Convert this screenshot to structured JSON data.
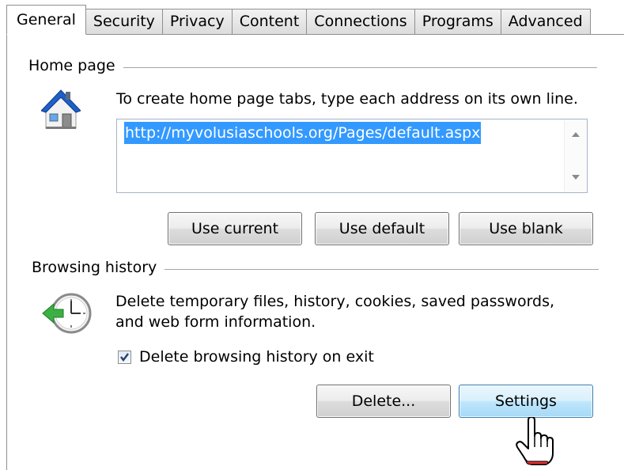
{
  "tabs": [
    {
      "label": "General",
      "active": true
    },
    {
      "label": "Security",
      "active": false
    },
    {
      "label": "Privacy",
      "active": false
    },
    {
      "label": "Content",
      "active": false
    },
    {
      "label": "Connections",
      "active": false
    },
    {
      "label": "Programs",
      "active": false
    },
    {
      "label": "Advanced",
      "active": false
    }
  ],
  "home_page": {
    "title": "Home page",
    "description": "To create home page tabs, type each address on its own line.",
    "url": "http://myvolusiaschools.org/Pages/default.aspx",
    "icon": "house-icon",
    "buttons": {
      "use_current": "Use current",
      "use_default": "Use default",
      "use_blank": "Use blank"
    }
  },
  "browsing_history": {
    "title": "Browsing history",
    "description_line1": "Delete temporary files, history, cookies, saved passwords,",
    "description_line2": "and web form information.",
    "icon": "clock-delete-icon",
    "checkbox_label": "Delete browsing history on exit",
    "checkbox_checked": true,
    "buttons": {
      "delete": "Delete...",
      "settings": "Settings"
    }
  },
  "colors": {
    "selection": "#3399ff",
    "hot_button_border": "#3c7fb1",
    "group_line": "#a5a5a5"
  }
}
